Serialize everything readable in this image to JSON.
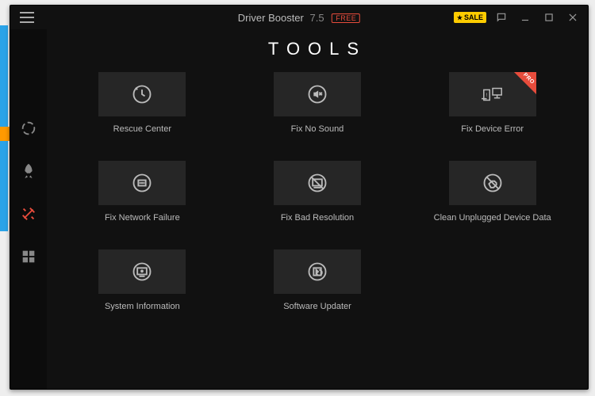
{
  "titlebar": {
    "app_name": "Driver Booster",
    "version": "7.5",
    "free_label": "FREE",
    "sale_label": "SALE"
  },
  "page": {
    "title": "TOOLS"
  },
  "tools": [
    {
      "label": "Rescue Center",
      "pro": false
    },
    {
      "label": "Fix No Sound",
      "pro": false
    },
    {
      "label": "Fix Device Error",
      "pro": true,
      "pro_label": "PRO"
    },
    {
      "label": "Fix Network Failure",
      "pro": false
    },
    {
      "label": "Fix Bad Resolution",
      "pro": false
    },
    {
      "label": "Clean Unplugged Device Data",
      "pro": false
    },
    {
      "label": "System Information",
      "pro": false
    },
    {
      "label": "Software Updater",
      "pro": false
    }
  ]
}
